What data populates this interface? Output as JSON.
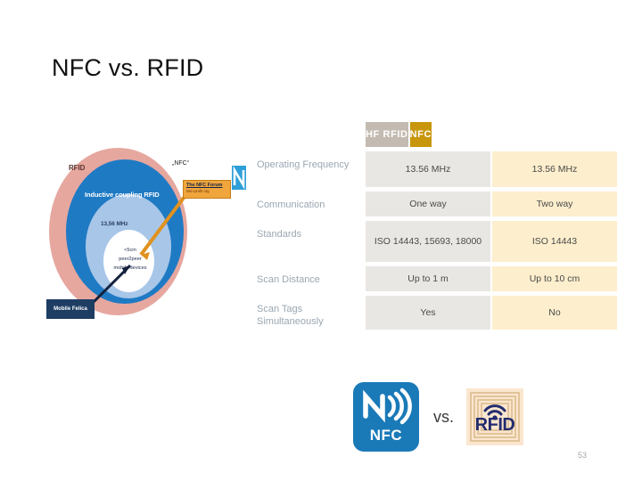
{
  "slide": {
    "title": "NFC vs. RFID",
    "page_number": "53",
    "background_color": "#ffffff"
  },
  "venn": {
    "outer_label": "RFID",
    "second_label": "Inductive coupling RFID",
    "third_label": "13,56 MHz",
    "core_lines": [
      "<5cm",
      "peer2peer",
      "mobile devices"
    ],
    "nfc_quote": "„NFC“",
    "forum_title": "The NFC Forum",
    "forum_subtitle": "Non-profit org",
    "felica_label": "Mobile Felica",
    "colors": {
      "outer": "#e6a79f",
      "second": "#1f7ac4",
      "third": "#a8c6e8",
      "core": "#ffffff",
      "forum_box": "#f0a63c",
      "felica_box": "#1d3d63",
      "n_logo": "#2e9fd8"
    }
  },
  "table": {
    "columns": [
      "HF RFID",
      "NFC"
    ],
    "header_colors": [
      "#c3bbb1",
      "#c8960c"
    ],
    "cell_colors": [
      "#e9e7e3",
      "#fdeecd"
    ],
    "label_color": "#9aa7b2",
    "rows": [
      {
        "label": "Operating Frequency",
        "hf_rfid": "13.56 MHz",
        "nfc": "13.56 MHz"
      },
      {
        "label": "Communication",
        "hf_rfid": "One way",
        "nfc": "Two way"
      },
      {
        "label": "Standards",
        "hf_rfid": "ISO 14443, 15693, 18000",
        "nfc": "ISO 14443"
      },
      {
        "label": "Scan Distance",
        "hf_rfid": "Up to 1 m",
        "nfc": "Up to 10 cm"
      },
      {
        "label": "Scan Tags Simultaneously",
        "hf_rfid": "Yes",
        "nfc": "No"
      }
    ]
  },
  "logos": {
    "nfc_label": "NFC",
    "vs_label": "vs.",
    "rfid_label": "RFID",
    "nfc_color": "#1a7ab8",
    "rfid_bg_color": "#fbe6cf",
    "rfid_text_color": "#232c6e"
  }
}
